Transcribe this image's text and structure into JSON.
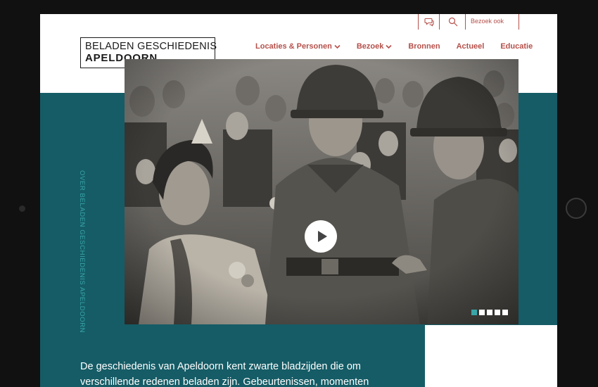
{
  "utility_bar": {
    "chat_icon": "chat-bubble-icon",
    "search_icon": "search-icon",
    "bezoek_ook_label": "Bezoek ook"
  },
  "logo": {
    "line1": "BELADEN GESCHIEDENIS",
    "line2": "APELDOORN"
  },
  "nav": {
    "items": [
      {
        "label": "Locaties & Personen",
        "has_dropdown": true
      },
      {
        "label": "Bezoek",
        "has_dropdown": true
      },
      {
        "label": "Bronnen",
        "has_dropdown": false
      },
      {
        "label": "Actueel",
        "has_dropdown": false
      },
      {
        "label": "Educatie",
        "has_dropdown": false
      }
    ]
  },
  "hero": {
    "play_icon": "play-icon",
    "carousel": {
      "count": 5,
      "active_index": 0
    }
  },
  "side_label": "OVER BELADEN GESCHIEDENIS APELDOORN",
  "intro": {
    "line1": "De geschiedenis van Apeldoorn kent zwarte bladzijden die om",
    "line2": "verschillende redenen beladen zijn. Gebeurtenissen, momenten"
  },
  "colors": {
    "accent_red": "#b5504a",
    "teal": "#155c66",
    "teal_light": "#3aa5a8"
  }
}
